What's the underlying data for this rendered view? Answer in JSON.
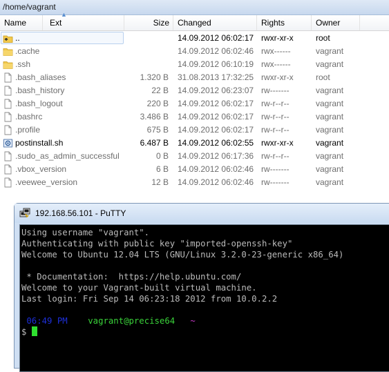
{
  "panel": {
    "path": "/home/vagrant",
    "columns": {
      "name": "Name",
      "ext": "Ext",
      "size": "Size",
      "changed": "Changed",
      "rights": "Rights",
      "owner": "Owner"
    },
    "files": [
      {
        "name": "..",
        "size": "",
        "changed": "14.09.2012 06:02:17",
        "rights": "rwxr-xr-x",
        "owner": "root",
        "icon": "parent-folder-icon"
      },
      {
        "name": ".cache",
        "size": "",
        "changed": "14.09.2012 06:02:46",
        "rights": "rwx------",
        "owner": "vagrant",
        "icon": "folder-icon"
      },
      {
        "name": ".ssh",
        "size": "",
        "changed": "14.09.2012 06:10:19",
        "rights": "rwx------",
        "owner": "vagrant",
        "icon": "folder-icon"
      },
      {
        "name": ".bash_aliases",
        "size": "1.320 B",
        "changed": "31.08.2013 17:32:25",
        "rights": "rwxr-xr-x",
        "owner": "root",
        "icon": "file-icon"
      },
      {
        "name": ".bash_history",
        "size": "22 B",
        "changed": "14.09.2012 06:23:07",
        "rights": "rw-------",
        "owner": "vagrant",
        "icon": "file-icon"
      },
      {
        "name": ".bash_logout",
        "size": "220 B",
        "changed": "14.09.2012 06:02:17",
        "rights": "rw-r--r--",
        "owner": "vagrant",
        "icon": "file-icon"
      },
      {
        "name": ".bashrc",
        "size": "3.486 B",
        "changed": "14.09.2012 06:02:17",
        "rights": "rw-r--r--",
        "owner": "vagrant",
        "icon": "file-icon"
      },
      {
        "name": ".profile",
        "size": "675 B",
        "changed": "14.09.2012 06:02:17",
        "rights": "rw-r--r--",
        "owner": "vagrant",
        "icon": "file-icon"
      },
      {
        "name": "postinstall.sh",
        "size": "6.487 B",
        "changed": "14.09.2012 06:02:55",
        "rights": "rwxr-xr-x",
        "owner": "vagrant",
        "icon": "script-icon"
      },
      {
        "name": ".sudo_as_admin_successful",
        "size": "0 B",
        "changed": "14.09.2012 06:17:36",
        "rights": "rw-r--r--",
        "owner": "vagrant",
        "icon": "file-icon"
      },
      {
        "name": ".vbox_version",
        "size": "6 B",
        "changed": "14.09.2012 06:02:46",
        "rights": "rw-------",
        "owner": "vagrant",
        "icon": "file-icon"
      },
      {
        "name": ".veewee_version",
        "size": "12 B",
        "changed": "14.09.2012 06:02:46",
        "rights": "rw-------",
        "owner": "vagrant",
        "icon": "file-icon"
      }
    ]
  },
  "putty": {
    "title": "192.168.56.101 - PuTTY",
    "lines": [
      "Using username \"vagrant\".",
      "Authenticating with public key \"imported-openssh-key\"",
      "Welcome to Ubuntu 12.04 LTS (GNU/Linux 3.2.0-23-generic x86_64)",
      "",
      " * Documentation:  https://help.ubuntu.com/",
      "Welcome to your Vagrant-built virtual machine.",
      "Last login: Fri Sep 14 06:23:18 2012 from 10.0.2.2",
      ""
    ],
    "prompt": {
      "time": "06:49 PM",
      "user_host": "vagrant@precise64",
      "cwd": "~",
      "symbol": "$"
    }
  },
  "colors": {
    "prompt_time": "#1d2fd9",
    "prompt_user": "#3ad33a",
    "prompt_cwd": "#c838c8",
    "cursor": "#2fe02f"
  }
}
